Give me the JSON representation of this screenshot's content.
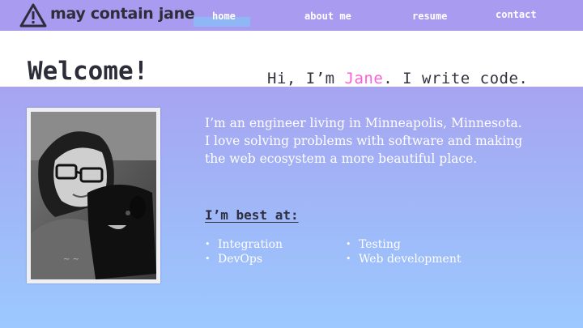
{
  "brand": {
    "name": "may contain jane",
    "icon": "warning-triangle-icon"
  },
  "nav": [
    {
      "label": "home",
      "active": true
    },
    {
      "label": "about me",
      "active": false
    },
    {
      "label": "resume",
      "active": false
    },
    {
      "label": "contact",
      "active": false
    }
  ],
  "welcome": {
    "title": "Welcome!",
    "tagline_prefix": "Hi, I’m ",
    "tagline_name": "Jane",
    "tagline_suffix": ". I write code."
  },
  "intro": "I’m an engineer living in Minneapolis, Minnesota. I love solving problems with software and making the web ecosystem a more beautiful place.",
  "best_at": {
    "heading": "I’m best at:",
    "left": [
      "Integration",
      "DevOps"
    ],
    "right": [
      "Testing",
      "Web development"
    ]
  },
  "colors": {
    "header": "#a89bf0",
    "accent_name": "#ff5fd6",
    "gradient_top": "#a7a4f1",
    "gradient_bottom": "#9cc8ff"
  }
}
